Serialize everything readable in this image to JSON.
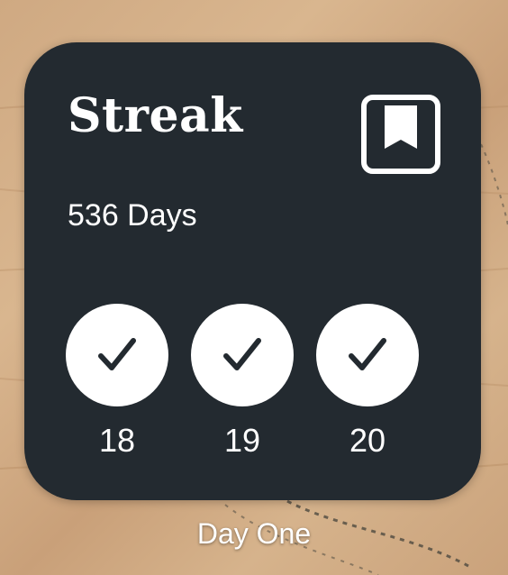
{
  "widget": {
    "title": "Streak",
    "app_icon": "bookmark-icon",
    "streak_count": "536 Days",
    "days": [
      {
        "label": "18",
        "completed": true,
        "icon": "checkmark-icon"
      },
      {
        "label": "19",
        "completed": true,
        "icon": "checkmark-icon"
      },
      {
        "label": "20",
        "completed": true,
        "icon": "checkmark-icon"
      }
    ],
    "colors": {
      "background": "#232a30",
      "text": "#ffffff",
      "day_circle": "#ffffff",
      "checkmark": "#232a30"
    }
  },
  "caption": "Day One"
}
